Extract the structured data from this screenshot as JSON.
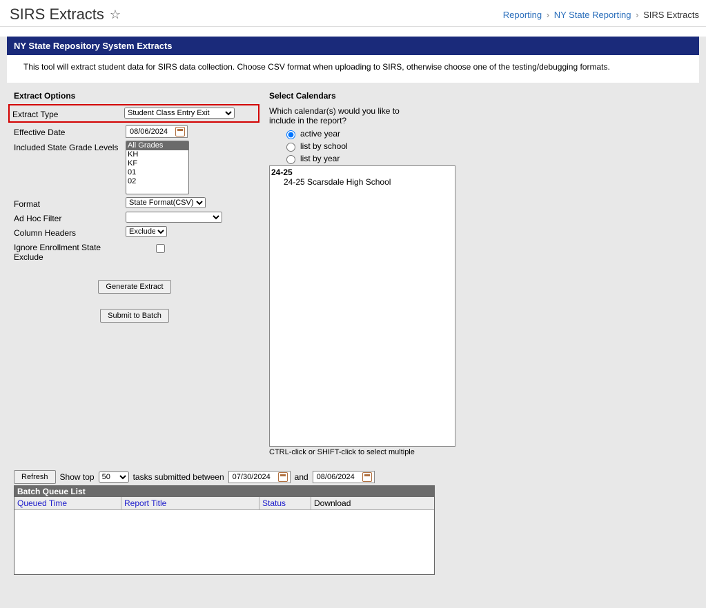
{
  "header": {
    "title": "SIRS Extracts",
    "breadcrumb": [
      "Reporting",
      "NY State Reporting",
      "SIRS Extracts"
    ]
  },
  "banner": "NY State Repository System Extracts",
  "intro": "This tool will extract student data for SIRS data collection. Choose CSV format when uploading to SIRS, otherwise choose one of the testing/debugging formats.",
  "extract_options": {
    "section_title": "Extract Options",
    "fields": {
      "extract_type": {
        "label": "Extract Type",
        "value": "Student Class Entry Exit"
      },
      "effective_date": {
        "label": "Effective Date",
        "value": "08/06/2024"
      },
      "grade_levels": {
        "label": "Included State Grade Levels",
        "options": [
          "All Grades",
          "KH",
          "KF",
          "01",
          "02"
        ],
        "selected": "All Grades"
      },
      "format": {
        "label": "Format",
        "value": "State Format(CSV)"
      },
      "adhoc": {
        "label": "Ad Hoc Filter",
        "value": ""
      },
      "column_headers": {
        "label": "Column Headers",
        "value": "Exclude"
      },
      "ignore_exclude": {
        "label": "Ignore Enrollment State Exclude",
        "checked": false
      }
    },
    "buttons": {
      "generate": "Generate Extract",
      "submit": "Submit to Batch"
    }
  },
  "calendars": {
    "section_title": "Select Calendars",
    "prompt": "Which calendar(s) would you like to include in the report?",
    "radios": {
      "active": "active year",
      "school": "list by school",
      "year": "list by year",
      "selected": "active"
    },
    "list": {
      "year": "24-25",
      "school": "24-25 Scarsdale High School"
    },
    "hint": "CTRL-click or SHIFT-click to select multiple"
  },
  "batch": {
    "refresh": "Refresh",
    "show_top_label": "Show top",
    "show_top_value": "50",
    "between_label": "tasks submitted between",
    "from_date": "07/30/2024",
    "and": "and",
    "to_date": "08/06/2024",
    "queue_title": "Batch Queue List",
    "columns": {
      "time": "Queued Time",
      "title": "Report Title",
      "status": "Status",
      "download": "Download"
    }
  }
}
